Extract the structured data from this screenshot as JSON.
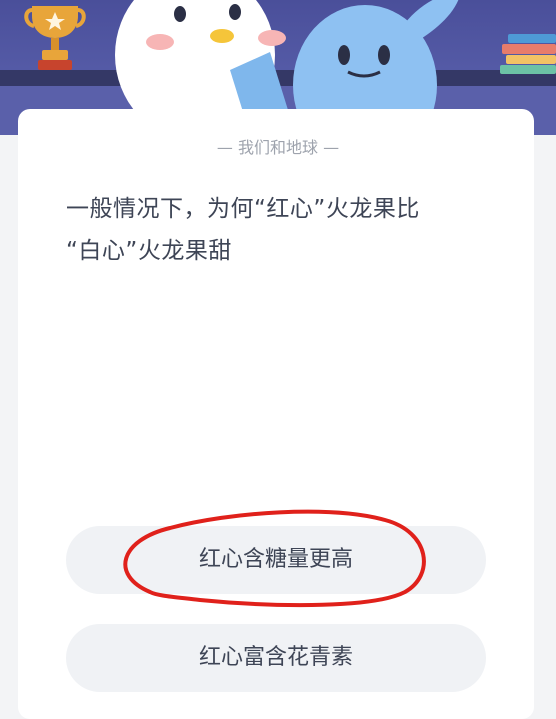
{
  "quiz": {
    "section_title": "— 我们和地球 —",
    "question_line1": "一般情况下，为何“红心”火龙果比",
    "question_line2": "“白心”火龙果甜",
    "options": [
      {
        "label": "红心含糖量更高"
      },
      {
        "label": "红心富含花青素"
      }
    ]
  },
  "colors": {
    "hero_bg": "#4a4f9a",
    "card_bg": "#ffffff",
    "option_bg": "#f0f2f5",
    "text": "#3e4556",
    "muted": "#9ea3ad",
    "annotation": "#e0211b"
  },
  "icons": [
    "trophy-icon",
    "books-icon",
    "mascot-penguin",
    "mascot-blue-rabbit"
  ]
}
